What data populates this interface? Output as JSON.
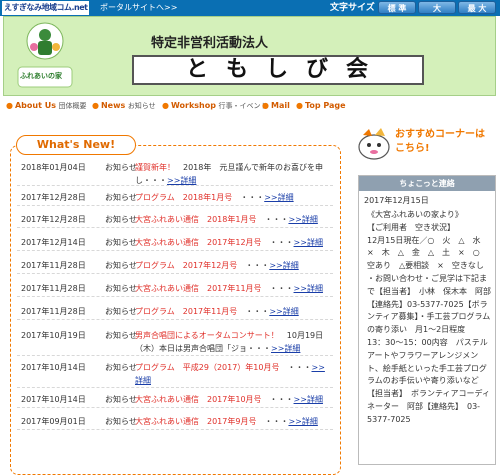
{
  "topbar": {
    "portal_logo_text": "えすぎなみ地域コム.net",
    "portal_link": "ポータルサイトへ>>",
    "fontsize_label": "文字サイズ",
    "fontsize_buttons": [
      "標 準",
      "大",
      "最 大"
    ],
    "colors": {
      "bar": "#0a6fb3",
      "button": "#2f7fc4"
    }
  },
  "header": {
    "org_type": "特定非営利活動法人",
    "org_name": "ともしび会",
    "mascot_logo_text": "ふれあいの家",
    "background": "#d4f0ba"
  },
  "nav": {
    "items": [
      {
        "en": "About Us",
        "ja": "団体概要"
      },
      {
        "en": "News",
        "ja": "お知らせ"
      },
      {
        "en": "Workshop",
        "ja": "行事・イベント"
      },
      {
        "en": "Mail",
        "ja": ""
      },
      {
        "en": "Top Page",
        "ja": ""
      }
    ],
    "accent": "#f07800"
  },
  "news": {
    "heading": "What's New!",
    "items": [
      {
        "date": "2018年01月04日",
        "category": "お知らせ",
        "title": "謹賀新年！",
        "rest": "　2018年　元旦謹んで新年のお喜びを申し・・・",
        "link": ">>詳細"
      },
      {
        "date": "2017年12月28日",
        "category": "お知らせ",
        "title": "プログラム　2018年1月号",
        "rest": "　・・・",
        "link": ">>詳細"
      },
      {
        "date": "2017年12月28日",
        "category": "お知らせ",
        "title": "大宮ふれあい通信　2018年1月号",
        "rest": "　・・・",
        "link": ">>詳細"
      },
      {
        "date": "2017年12月14日",
        "category": "お知らせ",
        "title": "大宮ふれあい通信　2017年12月号",
        "rest": "　・・・",
        "link": ">>詳細"
      },
      {
        "date": "2017年11月28日",
        "category": "お知らせ",
        "title": "プログラム　2017年12月号",
        "rest": "　・・・",
        "link": ">>詳細"
      },
      {
        "date": "2017年11月28日",
        "category": "お知らせ",
        "title": "大宮ふれあい通信　2017年11月号",
        "rest": "　・・・",
        "link": ">>詳細"
      },
      {
        "date": "2017年11月28日",
        "category": "お知らせ",
        "title": "プログラム　2017年11月号",
        "rest": "　・・・",
        "link": ">>詳細"
      },
      {
        "date": "2017年10月19日",
        "category": "お知らせ",
        "title": "男声合唱団によるオータムコンサート！",
        "rest": "　10月19日（木）本日は男声合唱団「ジョ・・・",
        "link": ">>詳細"
      },
      {
        "date": "2017年10月14日",
        "category": "お知らせ",
        "title": "プログラム　平成29（2017）年10月号",
        "rest": "　・・・",
        "link": ">>詳細"
      },
      {
        "date": "2017年10月14日",
        "category": "お知らせ",
        "title": "大宮ふれあい通信　2017年10月号",
        "rest": "　・・・",
        "link": ">>詳細"
      },
      {
        "date": "2017年09月01日",
        "category": "お知らせ",
        "title": "大宮ふれあい通信　2017年9月号",
        "rest": "　・・・",
        "link": ">>詳細"
      }
    ],
    "colors": {
      "title": "#e0302a",
      "link": "#1a3ea8",
      "border": "#f07800"
    }
  },
  "sidebar": {
    "banner_text": "おすすめコーナーはこちら!",
    "box_title": "ちょこっと連絡",
    "date": "2017年12月15日",
    "body": "《大宮ふれあいの家より》\n【ご利用者　空き状況】\n12月15日現在／○　火　△　水　×　木　△　金　△　土　×　○　空あり　△要相談　×　空きなし\n・お問い合わせ・ご見学は下記まで【担当者】　小林　保木本　阿部【連絡先】03-5377-7025【ボランティア募集】・手工芸プログラムの寄り添い　月1～2日程度　13：30～15：00内容　パステルアートやフラワーアレンジメント、絵手紙といった手工芸プログラムのお手伝いや寄り添いなど【担当者】　ボランティアコーディネーター　阿部【連絡先】　03-5377-7025"
  }
}
